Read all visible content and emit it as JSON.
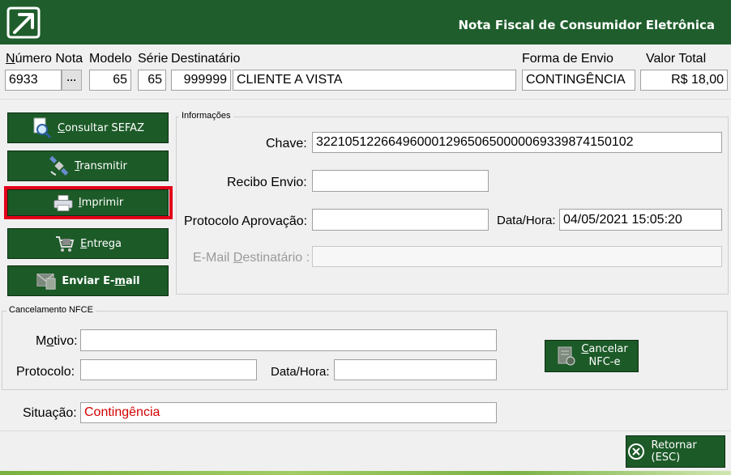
{
  "header": {
    "title": "Nota Fiscal de Consumidor Eletrônica"
  },
  "top": {
    "numero_label": "Número Nota",
    "modelo_label": "Modelo",
    "serie_label": "Série",
    "destinatario_label": "Destinatário",
    "forma_label": "Forma de Envio",
    "valor_label": "Valor Total",
    "numero_value": "6933",
    "dots_label": "···",
    "modelo_value": "65",
    "serie_value": "65",
    "dest_code": "999999",
    "dest_name": "CLIENTE A VISTA",
    "forma_value": "CONTINGÊNCIA",
    "valor_value": "R$ 18,00"
  },
  "actions": {
    "consultar": {
      "accel": "C",
      "rest": "onsultar SEFAZ"
    },
    "transmitir": {
      "accel": "T",
      "rest": "ransmitir"
    },
    "imprimir": {
      "accel": "I",
      "rest": "mprimir"
    },
    "entrega": {
      "accel": "E",
      "rest": "ntrega"
    },
    "email": {
      "pre": "Enviar E-",
      "accel": "m",
      "rest": "ail"
    }
  },
  "info": {
    "group_title": "Informações",
    "chave_label": "Chave:",
    "chave_value": "32210512266496000129650650000069339874150102",
    "recibo_label": "Recibo Envio:",
    "recibo_value": "",
    "protocolo_label": "Protocolo Aprovação:",
    "protocolo_value": "",
    "datahora_label": "Data/Hora:",
    "datahora_value": "04/05/2021 15:05:20",
    "email_pre": "E-Mail ",
    "email_accel": "D",
    "email_rest": "estinatário :",
    "email_value": ""
  },
  "cancel": {
    "group_title": "Cancelamento NFCE",
    "motivo_pre": "M",
    "motivo_accel": "o",
    "motivo_rest": "tivo:",
    "motivo_value": "",
    "protocolo_label": "Protocolo:",
    "protocolo_value": "",
    "datahora_label": "Data/Hora:",
    "datahora_value": "",
    "button_accel": "C",
    "button_rest": "ancelar",
    "button_line2": "NFC-e"
  },
  "situacao": {
    "label": "Situação:",
    "value": "Contingência",
    "value_color": "#d40000"
  },
  "footer": {
    "retornar_label": "Retornar (ESC)"
  }
}
